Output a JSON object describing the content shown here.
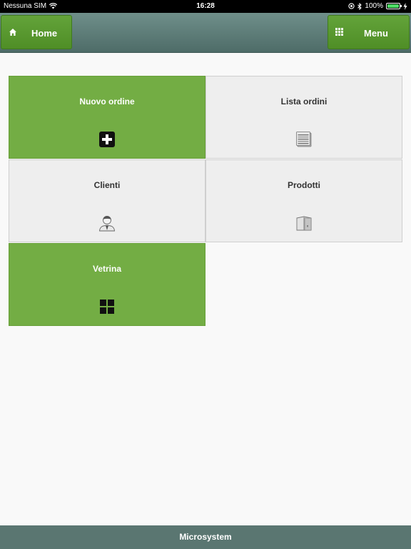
{
  "status_bar": {
    "carrier": "Nessuna SIM",
    "time": "16:28",
    "battery_percent": "100%",
    "battery_level": 1.0,
    "icons": [
      "wifi-icon",
      "location-icon",
      "bluetooth-icon",
      "battery-icon",
      "charging-icon"
    ]
  },
  "header": {
    "home_label": "Home",
    "menu_label": "Menu",
    "home_icon": "home-icon",
    "menu_icon": "grid-icon"
  },
  "tiles": [
    {
      "label": "Nuovo ordine",
      "icon": "plus-icon"
    },
    {
      "label": "Lista ordini",
      "icon": "document-list-icon"
    },
    {
      "label": "Clienti",
      "icon": "user-icon"
    },
    {
      "label": "Prodotti",
      "icon": "box-icon"
    },
    {
      "label": "Vetrina",
      "icon": "grid-icon"
    }
  ],
  "footer": {
    "text": "Microsystem"
  },
  "colors": {
    "accent_green": "#73ad44",
    "header_bg": "#5a7671",
    "tile_grey": "#eeeeee"
  }
}
